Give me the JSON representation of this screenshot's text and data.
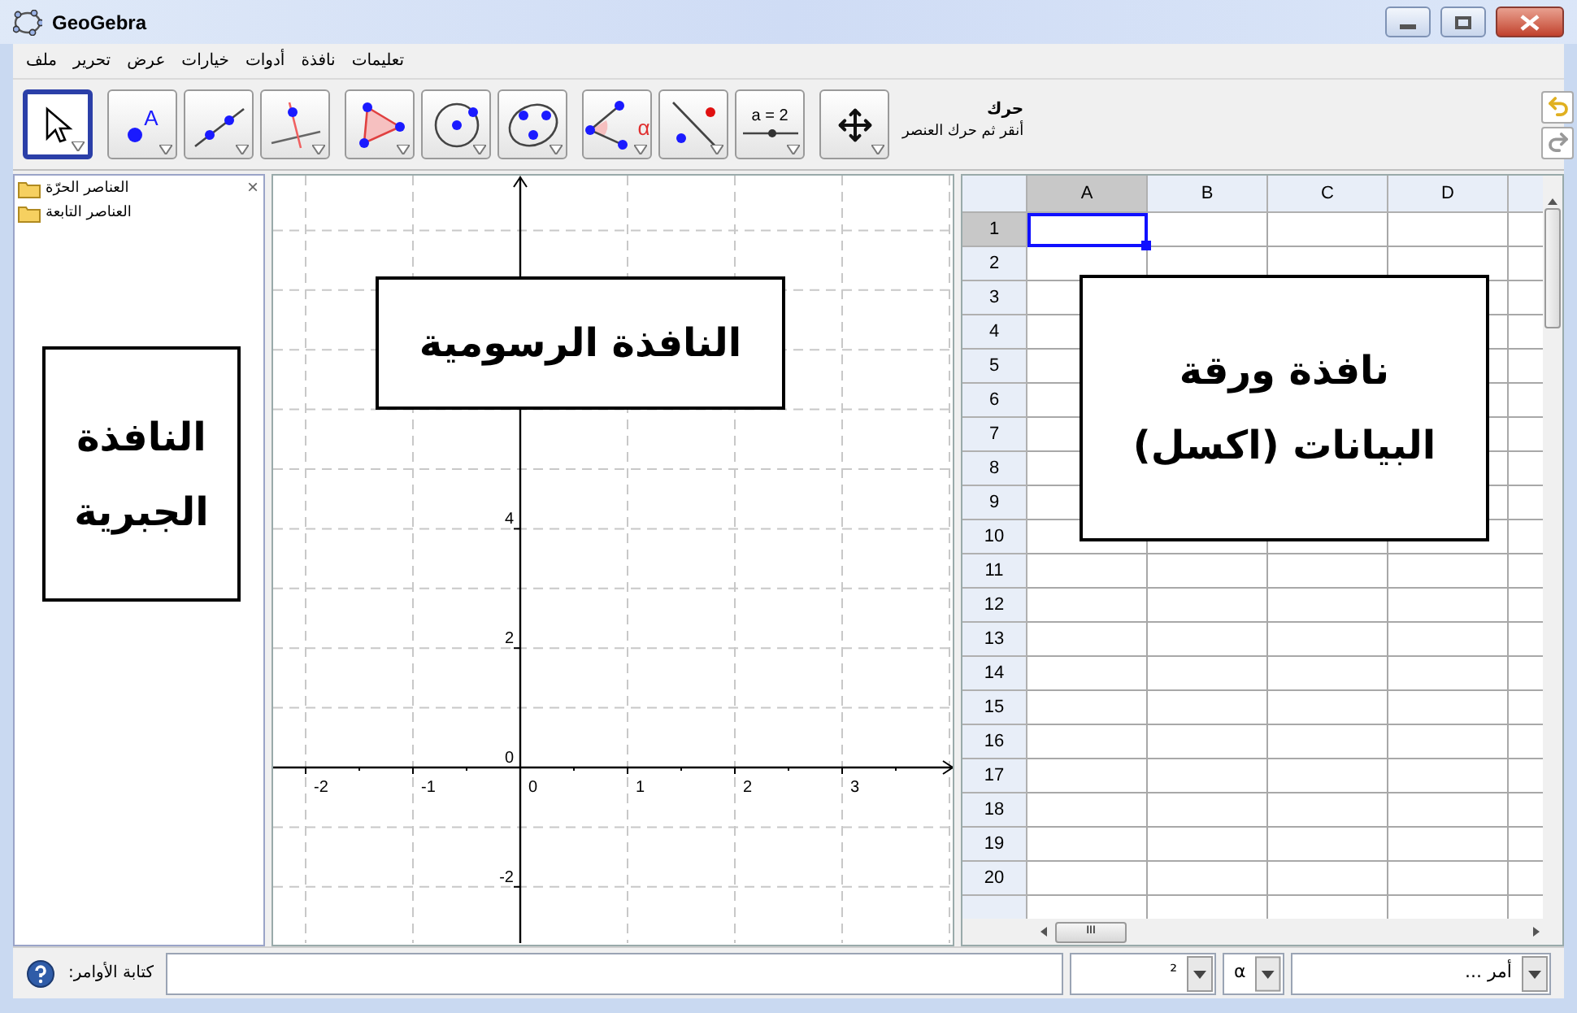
{
  "window": {
    "title": "GeoGebra"
  },
  "menu": [
    "تعليمات",
    "نافذة",
    "أدوات",
    "خيارات",
    "عرض",
    "تحرير",
    "ملف"
  ],
  "toolbar": {
    "tools": [
      {
        "kind": "move",
        "selected": true
      },
      {
        "kind": "point",
        "selected": false,
        "label": "A"
      },
      {
        "kind": "line",
        "selected": false
      },
      {
        "kind": "perpendicular",
        "selected": false
      },
      {
        "kind": "polygon",
        "selected": false
      },
      {
        "kind": "circle",
        "selected": false
      },
      {
        "kind": "conic",
        "selected": false
      },
      {
        "kind": "angle",
        "selected": false,
        "label": "α"
      },
      {
        "kind": "reflect",
        "selected": false
      },
      {
        "kind": "slider",
        "selected": false,
        "label": "a = 2"
      },
      {
        "kind": "move-view",
        "selected": false
      }
    ],
    "tool_name": "حرك",
    "tool_help": "أنقر ثم حرك العنصر"
  },
  "algebra": {
    "close_symbol": "×",
    "items": [
      "العناصر الحرّة",
      "العناصر التابعة"
    ],
    "callout": [
      "النافذة",
      "الجبرية"
    ]
  },
  "graphics": {
    "x_labels": [
      "3",
      "2",
      "1",
      "0",
      "-1",
      "-2"
    ],
    "y_labels": [
      "4",
      "2",
      "0",
      "-2"
    ],
    "callout": "النافذة الرسومية"
  },
  "spreadsheet": {
    "columns": [
      {
        "label": "D",
        "selected": false
      },
      {
        "label": "C",
        "selected": false
      },
      {
        "label": "B",
        "selected": false
      },
      {
        "label": "A",
        "selected": true
      }
    ],
    "rows": [
      {
        "label": "1",
        "selected": true
      },
      {
        "label": "2",
        "selected": false
      },
      {
        "label": "3",
        "selected": false
      },
      {
        "label": "4",
        "selected": false
      },
      {
        "label": "5",
        "selected": false
      },
      {
        "label": "6",
        "selected": false
      },
      {
        "label": "7",
        "selected": false
      },
      {
        "label": "8",
        "selected": false
      },
      {
        "label": "9",
        "selected": false
      },
      {
        "label": "10",
        "selected": false
      },
      {
        "label": "11",
        "selected": false
      },
      {
        "label": "12",
        "selected": false
      },
      {
        "label": "13",
        "selected": false
      },
      {
        "label": "14",
        "selected": false
      },
      {
        "label": "15",
        "selected": false
      },
      {
        "label": "16",
        "selected": false
      },
      {
        "label": "17",
        "selected": false
      },
      {
        "label": "18",
        "selected": false
      },
      {
        "label": "19",
        "selected": false
      },
      {
        "label": "20",
        "selected": false
      }
    ],
    "scroll_grip": "III",
    "callout": [
      "نافذة ورقة",
      "البيانات (اكسل)"
    ]
  },
  "input_bar": {
    "label": "كتابة الأوامر:",
    "symbols_value": "²",
    "greek_value": "α",
    "command_placeholder": "أمر ..."
  }
}
